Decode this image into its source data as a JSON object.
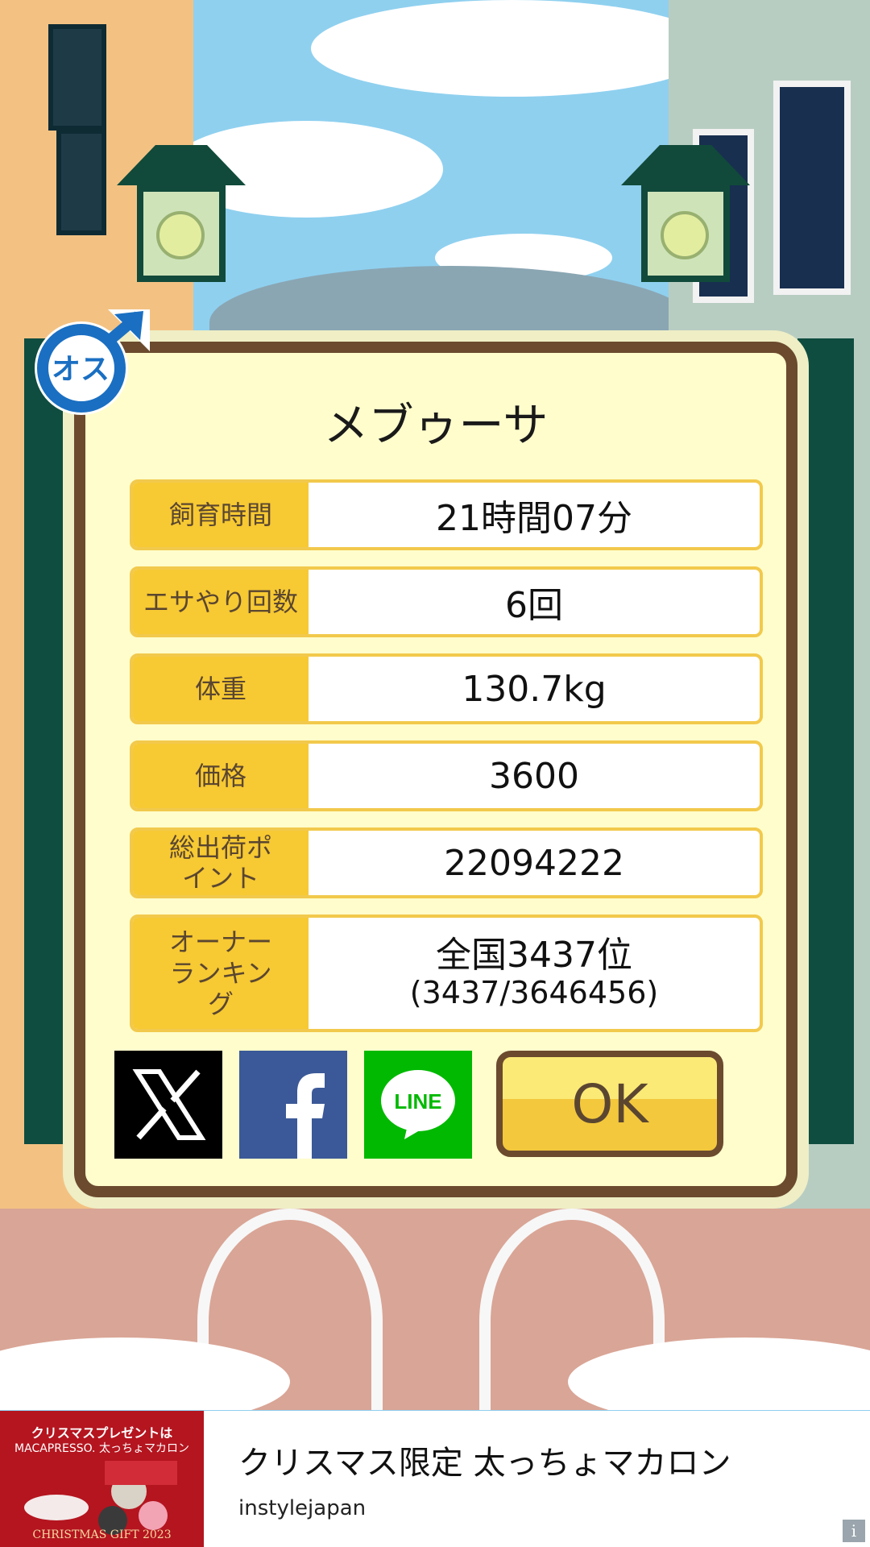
{
  "card": {
    "title": "メブゥーサ",
    "rows": [
      {
        "label": "飼育時間",
        "value": "21時間07分"
      },
      {
        "label": "エサやり回数",
        "value": "6回"
      },
      {
        "label": "体重",
        "value": "130.7kg"
      },
      {
        "label": "価格",
        "value": "3600"
      },
      {
        "label": "総出荷ポイント",
        "value": "22094222"
      }
    ],
    "ranking": {
      "label": "オーナーランキング",
      "rank": "全国3437位",
      "detail": "(3437/3646456)"
    },
    "ok_label": "OK",
    "share": {
      "line_label": "LINE"
    }
  },
  "badge": {
    "text": "オス"
  },
  "ad": {
    "image_line1": "クリスマスプレゼントは",
    "image_line2": "MACAPRESSO. 太っちょマカロン",
    "image_line3": "CHRISTMAS GIFT 2023",
    "title": "クリスマス限定 太っちょマカロン",
    "source": "instylejapan",
    "info_icon": "i"
  },
  "colors": {
    "accent": "#f7c933",
    "frame": "#6b4a2e",
    "panel": "#fffdcc"
  }
}
